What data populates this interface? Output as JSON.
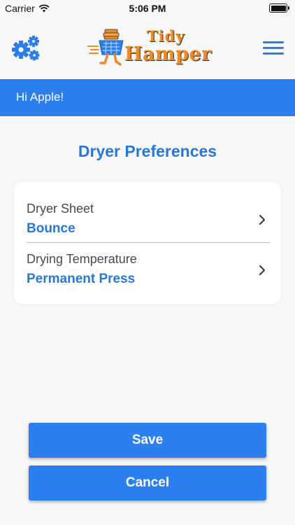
{
  "status_bar": {
    "carrier": "Carrier",
    "time": "5:06 PM"
  },
  "header": {
    "logo_line1": "Tidy",
    "logo_line2": "Hamper"
  },
  "greeting": "Hi Apple!",
  "page_title": "Dryer Preferences",
  "preferences": [
    {
      "label": "Dryer Sheet",
      "value": "Bounce"
    },
    {
      "label": "Drying Temperature",
      "value": "Permanent Press"
    }
  ],
  "buttons": {
    "save_label": "Save",
    "cancel_label": "Cancel"
  },
  "colors": {
    "accent_blue": "#2b7fef",
    "title_blue": "#2a77d6",
    "logo_orange": "#f08a24",
    "background": "#f7f7f7"
  },
  "icons": {
    "settings": "gears-icon",
    "menu": "hamburger-menu-icon",
    "row": "chevron-right-icon"
  }
}
